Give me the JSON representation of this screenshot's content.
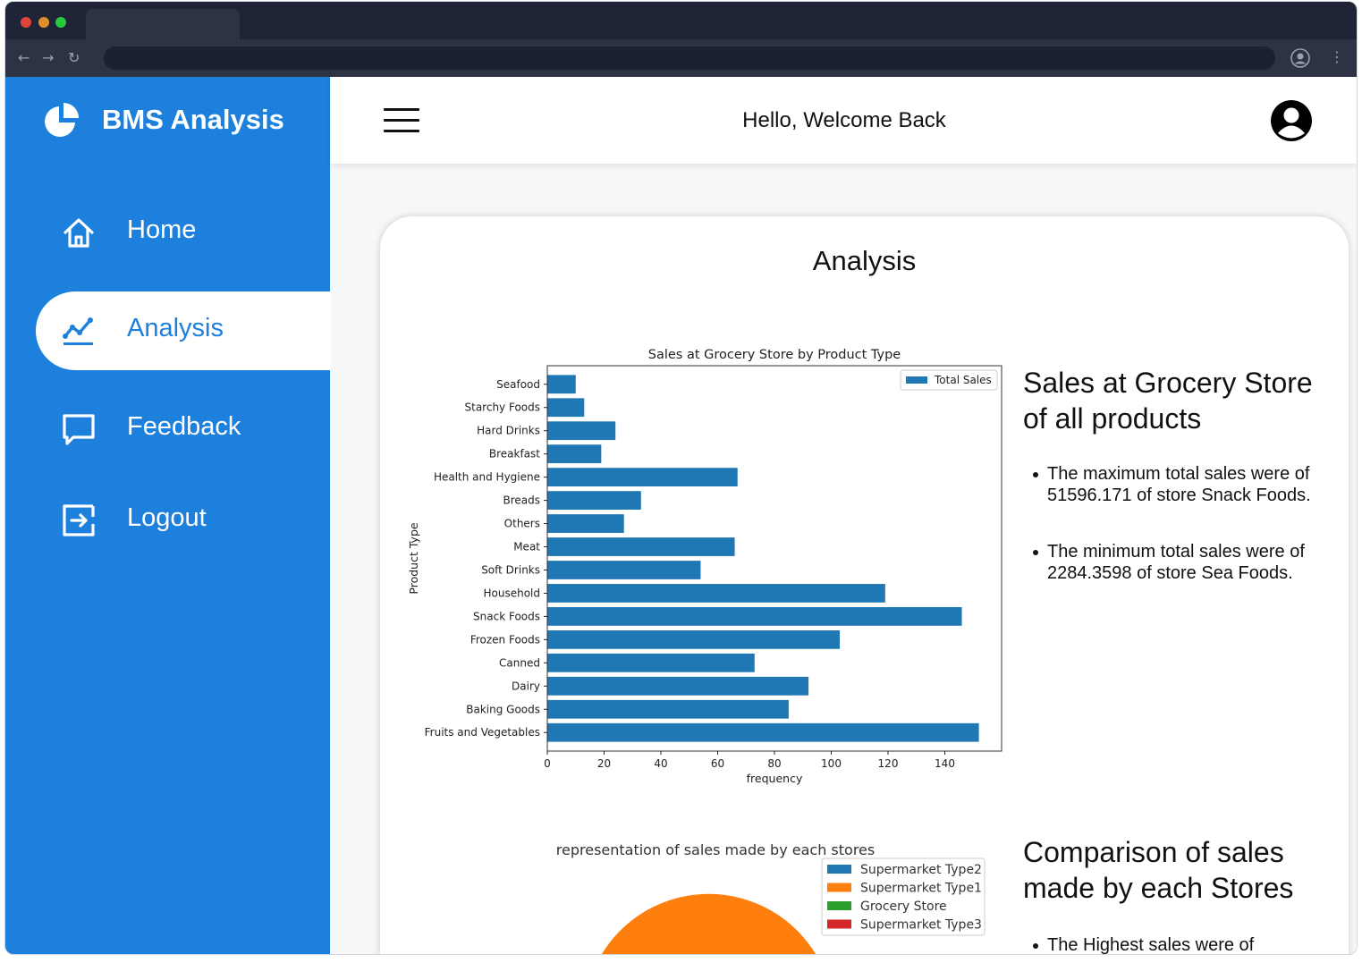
{
  "app": {
    "brand": "BMS Analysis",
    "greeting": "Hello, Welcome Back"
  },
  "sidebar": {
    "items": [
      {
        "label": "Home",
        "icon": "home-icon"
      },
      {
        "label": "Analysis",
        "icon": "analytics-icon",
        "active": true
      },
      {
        "label": "Feedback",
        "icon": "feedback-icon"
      },
      {
        "label": "Logout",
        "icon": "logout-icon"
      }
    ]
  },
  "main": {
    "title": "Analysis",
    "section1": {
      "title": "Sales at Grocery Store of all products",
      "bullet1": "The maximum total sales were of 51596.171 of store Snack Foods.",
      "bullet2": "The minimum total sales were of 2284.3598 of store Sea Foods."
    },
    "section2": {
      "title": "Comparison of sales made by each Stores",
      "bullet1": "The Highest  sales were of"
    }
  },
  "colors": {
    "sidebar": "#1c80dc",
    "bar": "#1f77b4",
    "type2": "#1f77b4",
    "type1": "#ff7f0e",
    "grocery": "#2ca02c",
    "type3": "#d62728"
  },
  "chart_data": [
    {
      "type": "bar",
      "orientation": "horizontal",
      "title": "Sales at Grocery Store by Product Type",
      "xlabel": "frequency",
      "ylabel": "Product Type",
      "xlim": [
        0,
        160
      ],
      "xticks": [
        0,
        20,
        40,
        60,
        80,
        100,
        120,
        140
      ],
      "legend": "top-right",
      "series": [
        {
          "name": "Total Sales",
          "categories": [
            "Seafood",
            "Starchy Foods",
            "Hard Drinks",
            "Breakfast",
            "Health and Hygiene",
            "Breads",
            "Others",
            "Meat",
            "Soft Drinks",
            "Household",
            "Snack Foods",
            "Frozen Foods",
            "Canned",
            "Dairy",
            "Baking Goods",
            "Fruits and Vegetables"
          ],
          "values": [
            10,
            13,
            24,
            19,
            67,
            33,
            27,
            66,
            54,
            119,
            146,
            103,
            73,
            92,
            85,
            152
          ]
        }
      ]
    },
    {
      "type": "pie",
      "title": "representation of sales made by each stores",
      "legend": "top-right",
      "labels": [
        "Supermarket Type2",
        "Supermarket Type1",
        "Grocery Store",
        "Supermarket Type3"
      ]
    }
  ]
}
